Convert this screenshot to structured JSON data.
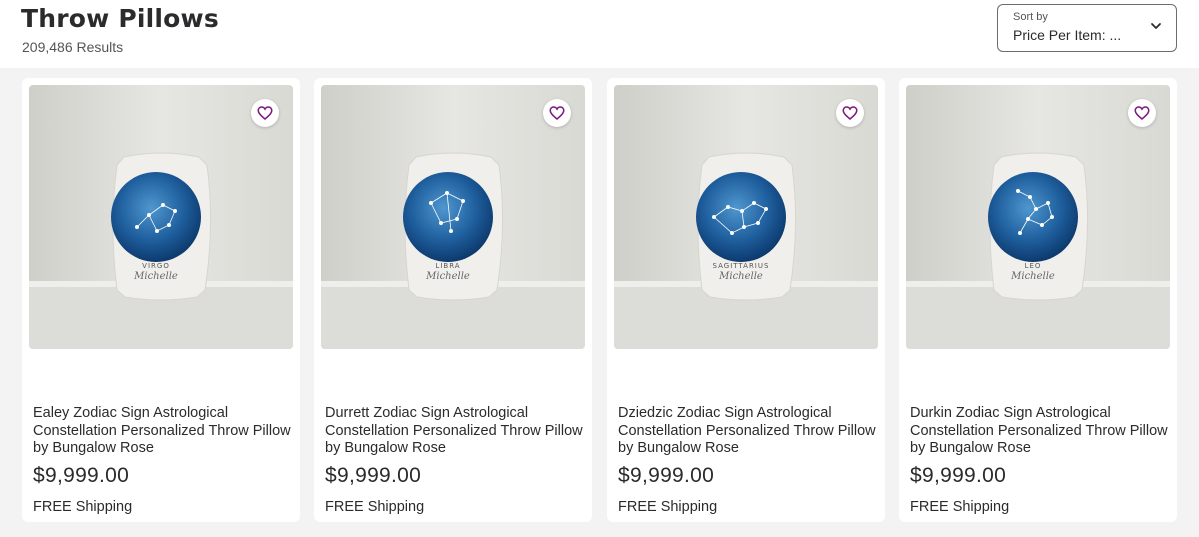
{
  "header": {
    "title": "Throw Pillows",
    "results": "209,486 Results"
  },
  "sort": {
    "label": "Sort by",
    "value": "Price Per Item: ...",
    "icon": "chevron-down-icon"
  },
  "colors": {
    "accent": "#7f187f",
    "background": "#f3f3f3",
    "text": "#2b2a2c"
  },
  "products": [
    {
      "name": "Ealey Zodiac Sign Astrological Constellation Personalized Throw Pillow by Bungalow Rose",
      "price": "$9,999.00",
      "shipping": "FREE Shipping",
      "sign": "VIRGO",
      "personalized": "Michelle"
    },
    {
      "name": "Durrett Zodiac Sign Astrological Constellation Personalized Throw Pillow by Bungalow Rose",
      "price": "$9,999.00",
      "shipping": "FREE Shipping",
      "sign": "LIBRA",
      "personalized": "Michelle"
    },
    {
      "name": "Dziedzic Zodiac Sign Astrological Constellation Personalized Throw Pillow by Bungalow Rose",
      "price": "$9,999.00",
      "shipping": "FREE Shipping",
      "sign": "SAGITTARIUS",
      "personalized": "Michelle"
    },
    {
      "name": "Durkin Zodiac Sign Astrological Constellation Personalized Throw Pillow by Bungalow Rose",
      "price": "$9,999.00",
      "shipping": "FREE Shipping",
      "sign": "LEO",
      "personalized": "Michelle"
    }
  ]
}
